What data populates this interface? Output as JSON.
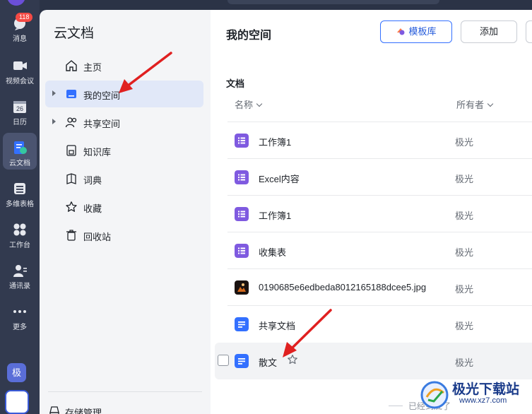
{
  "rail": {
    "badge": "118",
    "items": [
      {
        "label": "消息",
        "icon": "chat-icon"
      },
      {
        "label": "视频会议",
        "icon": "video-icon"
      },
      {
        "label": "日历",
        "icon": "calendar-icon",
        "day": "26"
      },
      {
        "label": "云文档",
        "icon": "cloud-docs-icon"
      },
      {
        "label": "多维表格",
        "icon": "base-icon"
      },
      {
        "label": "工作台",
        "icon": "workplace-icon"
      },
      {
        "label": "通讯录",
        "icon": "contacts-icon"
      },
      {
        "label": "更多",
        "icon": "more-icon"
      }
    ],
    "user_letter": "极"
  },
  "nav": {
    "title": "云文档",
    "items": [
      {
        "label": "主页",
        "icon": "home-icon"
      },
      {
        "label": "我的空间",
        "icon": "my-space-icon"
      },
      {
        "label": "共享空间",
        "icon": "shared-space-icon"
      },
      {
        "label": "知识库",
        "icon": "wiki-icon"
      },
      {
        "label": "词典",
        "icon": "dictionary-icon"
      },
      {
        "label": "收藏",
        "icon": "star-icon"
      },
      {
        "label": "回收站",
        "icon": "trash-icon"
      }
    ],
    "storage_label": "存储管理"
  },
  "main": {
    "title": "我的空间",
    "template_button": "模板库",
    "add_button": "添加",
    "section": "文档",
    "columns": {
      "name": "名称",
      "owner": "所有者"
    },
    "files": [
      {
        "name": "工作簿1",
        "owner": "极光",
        "type": "sheet"
      },
      {
        "name": "Excel内容",
        "owner": "极光",
        "type": "sheet"
      },
      {
        "name": "工作簿1",
        "owner": "极光",
        "type": "sheet"
      },
      {
        "name": "收集表",
        "owner": "极光",
        "type": "sheet"
      },
      {
        "name": "0190685e6edbeda8012165188dcee5.jpg",
        "owner": "极光",
        "type": "image"
      },
      {
        "name": "共享文档",
        "owner": "极光",
        "type": "doc"
      },
      {
        "name": "散文",
        "owner": "极光",
        "type": "doc"
      }
    ],
    "end_text": "已经到底了"
  },
  "watermark": {
    "title": "极光下载站",
    "url": "www.xz7.com"
  },
  "colors": {
    "accent": "#3370ff",
    "rail": "#323a4f",
    "annotation": "#e02020"
  }
}
